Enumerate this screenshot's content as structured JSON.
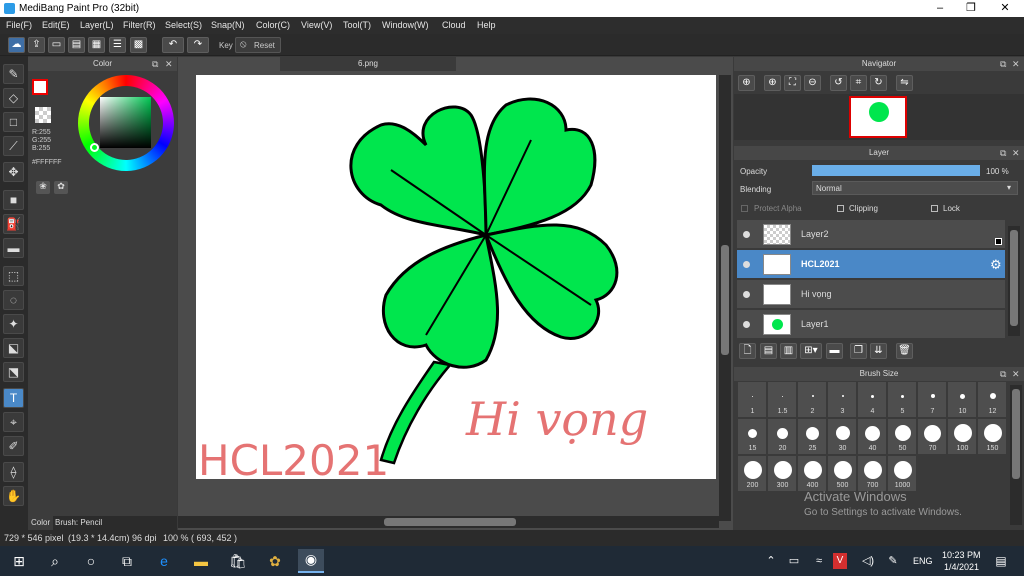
{
  "titlebar": {
    "title": "MediBang Paint Pro (32bit)",
    "minimize": "–",
    "maximize": "❐",
    "close": "✕"
  },
  "menu": [
    "File(F)",
    "Edit(E)",
    "Layer(L)",
    "Filter(R)",
    "Select(S)",
    "Snap(N)",
    "Color(C)",
    "View(V)",
    "Tool(T)",
    "Window(W)",
    "Cloud",
    "Help"
  ],
  "toolbar": {
    "key_label": "Key",
    "reset_label": "Reset"
  },
  "color_panel": {
    "title": "Color",
    "r": "R:255",
    "g": "G:255",
    "b": "B:255",
    "hex": "#FFFFFF",
    "tab_color": "Color",
    "tab_brush": "Brush: Pencil"
  },
  "canvas": {
    "tab": "6.png",
    "text1": "HCL2021",
    "text2": "Hi vọng"
  },
  "navigator": {
    "title": "Navigator"
  },
  "layer_panel": {
    "title": "Layer",
    "opacity_label": "Opacity",
    "opacity_value": "100 %",
    "opacity_fraction": 1.0,
    "blending_label": "Blending",
    "blending_value": "Normal",
    "protect_alpha": "Protect Alpha",
    "clipping": "Clipping",
    "lock": "Lock",
    "layers": [
      {
        "name": "Layer2"
      },
      {
        "name": "HCL2021"
      },
      {
        "name": "Hi vọng"
      },
      {
        "name": "Layer1"
      }
    ]
  },
  "brush_size": {
    "title": "Brush Size",
    "sizes": [
      "1",
      "1.5",
      "2",
      "3",
      "4",
      "5",
      "7",
      "10",
      "12",
      "15",
      "20",
      "25",
      "30",
      "40",
      "50",
      "70",
      "100",
      "150",
      "200",
      "300",
      "400",
      "500",
      "700",
      "1000"
    ]
  },
  "watermark": {
    "line1": "Activate Windows",
    "line2": "Go to Settings to activate Windows."
  },
  "status": {
    "size": "729 * 546 pixel",
    "cm": "(19.3 * 14.4cm)",
    "dpi": "96 dpi",
    "zoom": "100 %",
    "coords": "( 693, 452 )"
  },
  "taskbar": {
    "lang": "ENG",
    "time": "10:23 PM",
    "date": "1/4/2021"
  },
  "colors": {
    "accent": "#4a88c7",
    "clover": "#00e64d",
    "text_pink": "#e57373"
  }
}
